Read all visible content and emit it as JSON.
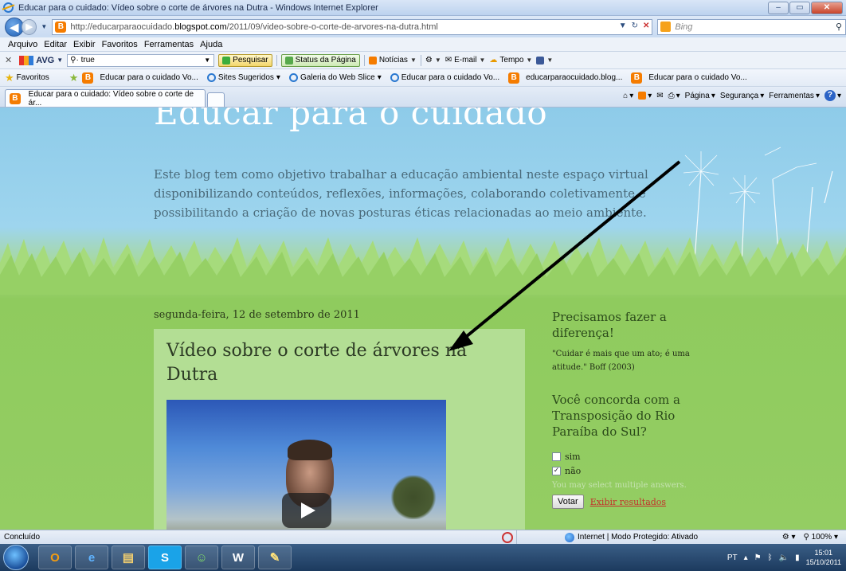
{
  "window": {
    "title": "Educar para o cuidado: Vídeo sobre o corte de árvores na Dutra - Windows Internet Explorer"
  },
  "address": {
    "url_prefix": "http://educarparaocuidado.",
    "url_domain": "blogspot.com",
    "url_path": "/2011/09/video-sobre-o-corte-de-arvores-na-dutra.html",
    "search_placeholder": "Bing"
  },
  "menu": [
    "Arquivo",
    "Editar",
    "Exibir",
    "Favoritos",
    "Ferramentas",
    "Ajuda"
  ],
  "avg_toolbar": {
    "brand": "AVG",
    "search_value": "true",
    "search_button": "Pesquisar",
    "status_button": "Status da Página",
    "news": "Notícias",
    "email": "E-mail",
    "weather": "Tempo"
  },
  "favorites_bar": {
    "label": "Favoritos",
    "items": [
      "Educar para o cuidado Vo...",
      "Sites Sugeridos",
      "Galeria do Web Slice",
      "Educar para o cuidado Vo...",
      "educarparaocuidado.blog...",
      "Educar para o cuidado Vo..."
    ]
  },
  "tab": {
    "label": "Educar para o cuidado: Vídeo sobre o corte de ár..."
  },
  "command_bar": {
    "page": "Página",
    "security": "Segurança",
    "tools": "Ferramentas"
  },
  "blog": {
    "title": "Educar para o cuidado",
    "description": "Este blog tem como objetivo trabalhar a educação ambiental neste espaço virtual disponibilizando conteúdos, reflexões, informações, colaborando coletivamente e possibilitando a criação de novas posturas éticas relacionadas ao meio ambiente."
  },
  "post": {
    "date": "segunda-feira, 12 de setembro de 2011",
    "title": "Vídeo sobre o corte de árvores na Dutra"
  },
  "sidebar": {
    "quote_title": "Precisamos fazer a diferença!",
    "quote": "\"Cuidar é mais que um ato; é uma atitude.\" Boff (2003)",
    "poll_title": "Você concorda com a Transposição do Rio Paraíba do Sul?",
    "poll_options": [
      {
        "label": "sim",
        "checked": false
      },
      {
        "label": "não",
        "checked": true
      }
    ],
    "poll_note": "You may select multiple answers.",
    "vote_button": "Votar",
    "results_link": "Exibir resultados"
  },
  "status_bar": {
    "status": "Concluído",
    "zone": "Internet | Modo Protegido: Ativado",
    "zoom": "100%"
  },
  "taskbar": {
    "language": "PT",
    "time": "15:01",
    "date": "15/10/2011"
  },
  "colors": {
    "sky": "#8ecbe9",
    "grass": "#94cd63",
    "post_bg": "#b3de94",
    "link": "#c4302b"
  }
}
